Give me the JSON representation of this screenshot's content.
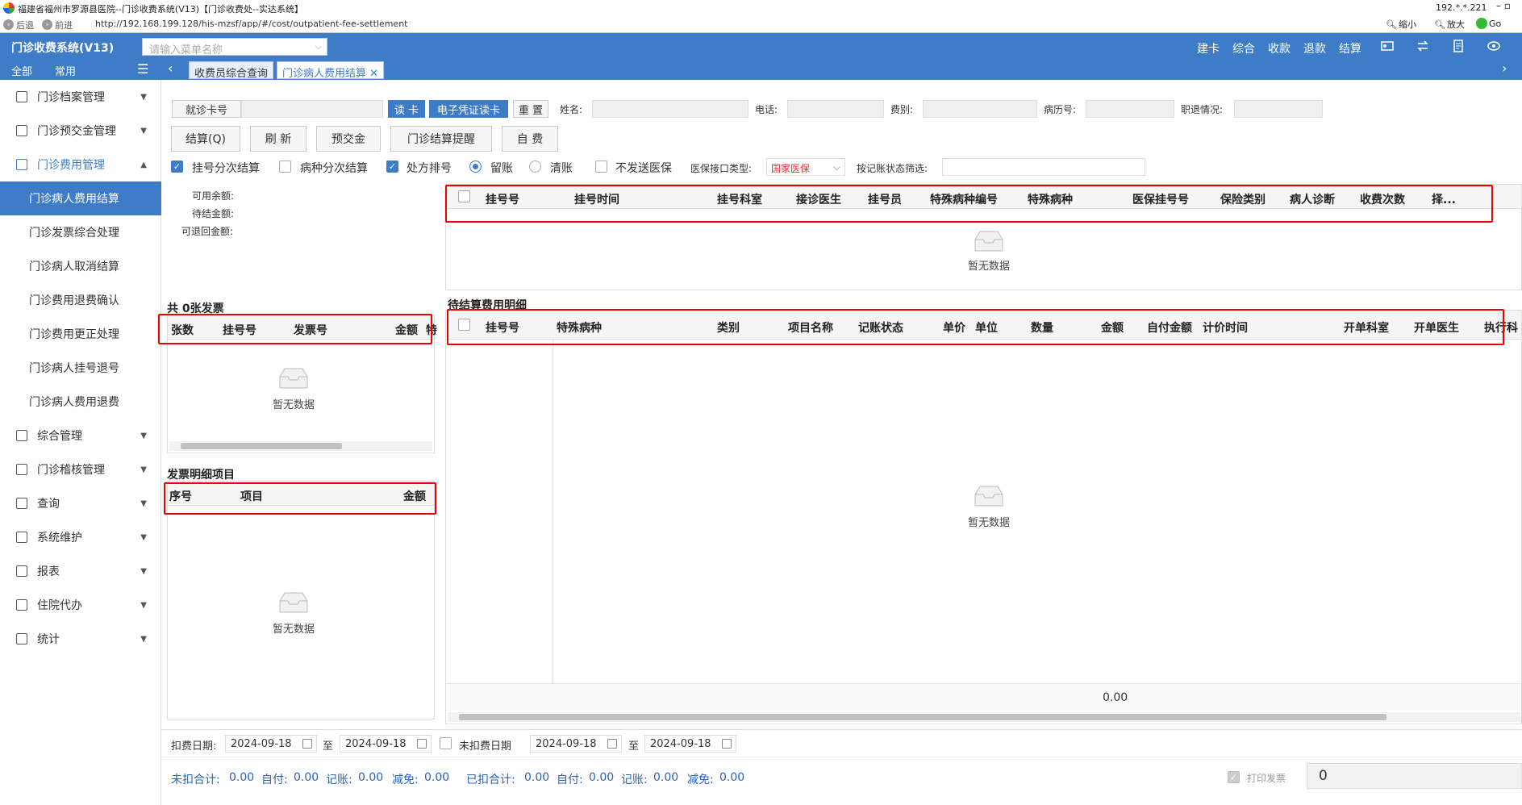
{
  "window": {
    "title": "福建省福州市罗源县医院--门诊收费系统(V13)【门诊收费处--实达系统】",
    "ip": "192.*.*.221"
  },
  "browser": {
    "back": "后退",
    "forward": "前进",
    "url": "http://192.168.199.128/his-mzsf/app/#/cost/outpatient-fee-settlement",
    "zoom_out": "缩小",
    "zoom_in": "放大",
    "go": "Go"
  },
  "app": {
    "title": "门诊收费系统(V13)",
    "menu_search_placeholder": "请输入菜单名称",
    "header_links": [
      "建卡",
      "综合",
      "收款",
      "退款",
      "结算"
    ]
  },
  "sidebar": {
    "tabs": [
      "全部",
      "常用"
    ],
    "items": [
      {
        "label": "门诊档案管理"
      },
      {
        "label": "门诊预交金管理"
      },
      {
        "label": "门诊费用管理"
      }
    ],
    "sub_items": [
      "门诊病人费用结算",
      "门诊发票综合处理",
      "门诊病人取消结算",
      "门诊费用退费确认",
      "门诊费用更正处理",
      "门诊病人挂号退号",
      "门诊病人费用退费"
    ],
    "more_items": [
      "综合管理",
      "门诊稽核管理",
      "查询",
      "系统维护",
      "报表",
      "住院代办",
      "统计"
    ]
  },
  "tabs": {
    "items": [
      "收费员综合查询",
      "门诊病人费用结算"
    ]
  },
  "search": {
    "card_label": "就诊卡号",
    "read_card": "读 卡",
    "e_card": "电子凭证读卡",
    "reset": "重 置",
    "name_label": "姓名:",
    "phone_label": "电话:",
    "fee_type_label": "费别:",
    "record_label": "病历号:",
    "job_label": "职退情况:"
  },
  "actions": {
    "settle": "结算(Q)",
    "refresh": "刷 新",
    "deposit": "预交金",
    "remind": "门诊结算提醒",
    "self_pay": "自 费"
  },
  "options": {
    "reg_split": "挂号分次结算",
    "disease_split": "病种分次结算",
    "rx_sort": "处方排号",
    "keep_account": "留账",
    "clear_account": "清账",
    "no_insurance": "不发送医保",
    "insurance_type_label": "医保接口类型:",
    "insurance_type_value": "国家医保",
    "status_filter_label": "按记账状态筛选:"
  },
  "balance": {
    "available": "可用余额:",
    "pending": "待结金额:",
    "refundable": "可退回金额:"
  },
  "invoice": {
    "count_title": "共 0张发票",
    "columns": [
      "张数",
      "挂号号",
      "发票号",
      "金额",
      "特"
    ],
    "empty": "暂无数据",
    "detail_title": "发票明细项目",
    "detail_columns": [
      "序号",
      "项目",
      "金额"
    ],
    "detail_empty": "暂无数据"
  },
  "registration": {
    "columns": [
      "挂号号",
      "挂号时间",
      "挂号科室",
      "接诊医生",
      "挂号员",
      "特殊病种编号",
      "特殊病种",
      "医保挂号号",
      "保险类别",
      "病人诊断",
      "收费次数",
      "择..."
    ],
    "empty": "暂无数据"
  },
  "pending_fees": {
    "title": "待结算费用明细",
    "columns": [
      "挂号号",
      "特殊病种",
      "类别",
      "项目名称",
      "记账状态",
      "单价",
      "单位",
      "数量",
      "金额",
      "自付金额",
      "计价时间",
      "开单科室",
      "开单医生",
      "执行科"
    ],
    "empty": "暂无数据",
    "total": "0.00"
  },
  "dates": {
    "deduct_label": "扣费日期:",
    "deduct_from": "2024-09-18",
    "to": "至",
    "deduct_to": "2024-09-18",
    "undeducted_label": "未扣费日期",
    "undeducted_from": "2024-09-18",
    "undeducted_to": "2024-09-18"
  },
  "summary": {
    "undeducted_total_label": "未扣合计:",
    "undeducted_total": "0.00",
    "self_label": "自付:",
    "self": "0.00",
    "account_label": "记账:",
    "account": "0.00",
    "relief_label": "减免:",
    "relief": "0.00",
    "deducted_total_label": "已扣合计:",
    "deducted_total": "0.00",
    "self2": "0.00",
    "account2": "0.00",
    "relief2": "0.00",
    "print_invoice": "打印发票",
    "amount": "0"
  },
  "colors": {
    "accent": "#3f7cc8",
    "highlight": "#e00000"
  }
}
